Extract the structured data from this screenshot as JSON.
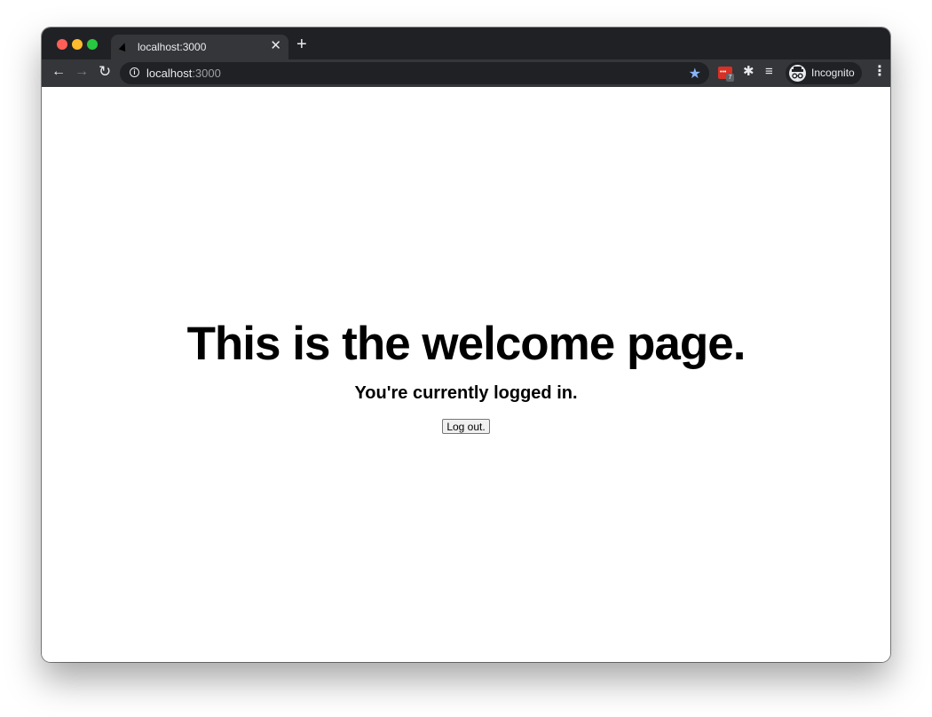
{
  "browser": {
    "tab": {
      "title": "localhost:3000",
      "favicon": "triangle-logo-icon",
      "close_glyph": "✕"
    },
    "new_tab_glyph": "+",
    "nav": {
      "back_glyph": "←",
      "forward_glyph": "→",
      "reload_glyph": "↻"
    },
    "address_bar": {
      "host": "localhost",
      "port": ":3000",
      "info_glyph": "i",
      "bookmark_glyph": "★",
      "bookmark_color": "#8ab4f8"
    },
    "extensions": {
      "badge_count": "7",
      "badge_color": "#d93025",
      "dots": "•••",
      "puzzle_glyph": "✱",
      "queue_glyph": "≡"
    },
    "profile": {
      "label": "Incognito"
    },
    "menu_glyph": "⋮"
  },
  "page": {
    "title": "This is the welcome page.",
    "status": "You're currently logged in.",
    "logout_label": "Log out."
  },
  "colors": {
    "chrome_dark": "#202124",
    "chrome_toolbar": "#35363a",
    "text_light": "#e8eaed"
  }
}
